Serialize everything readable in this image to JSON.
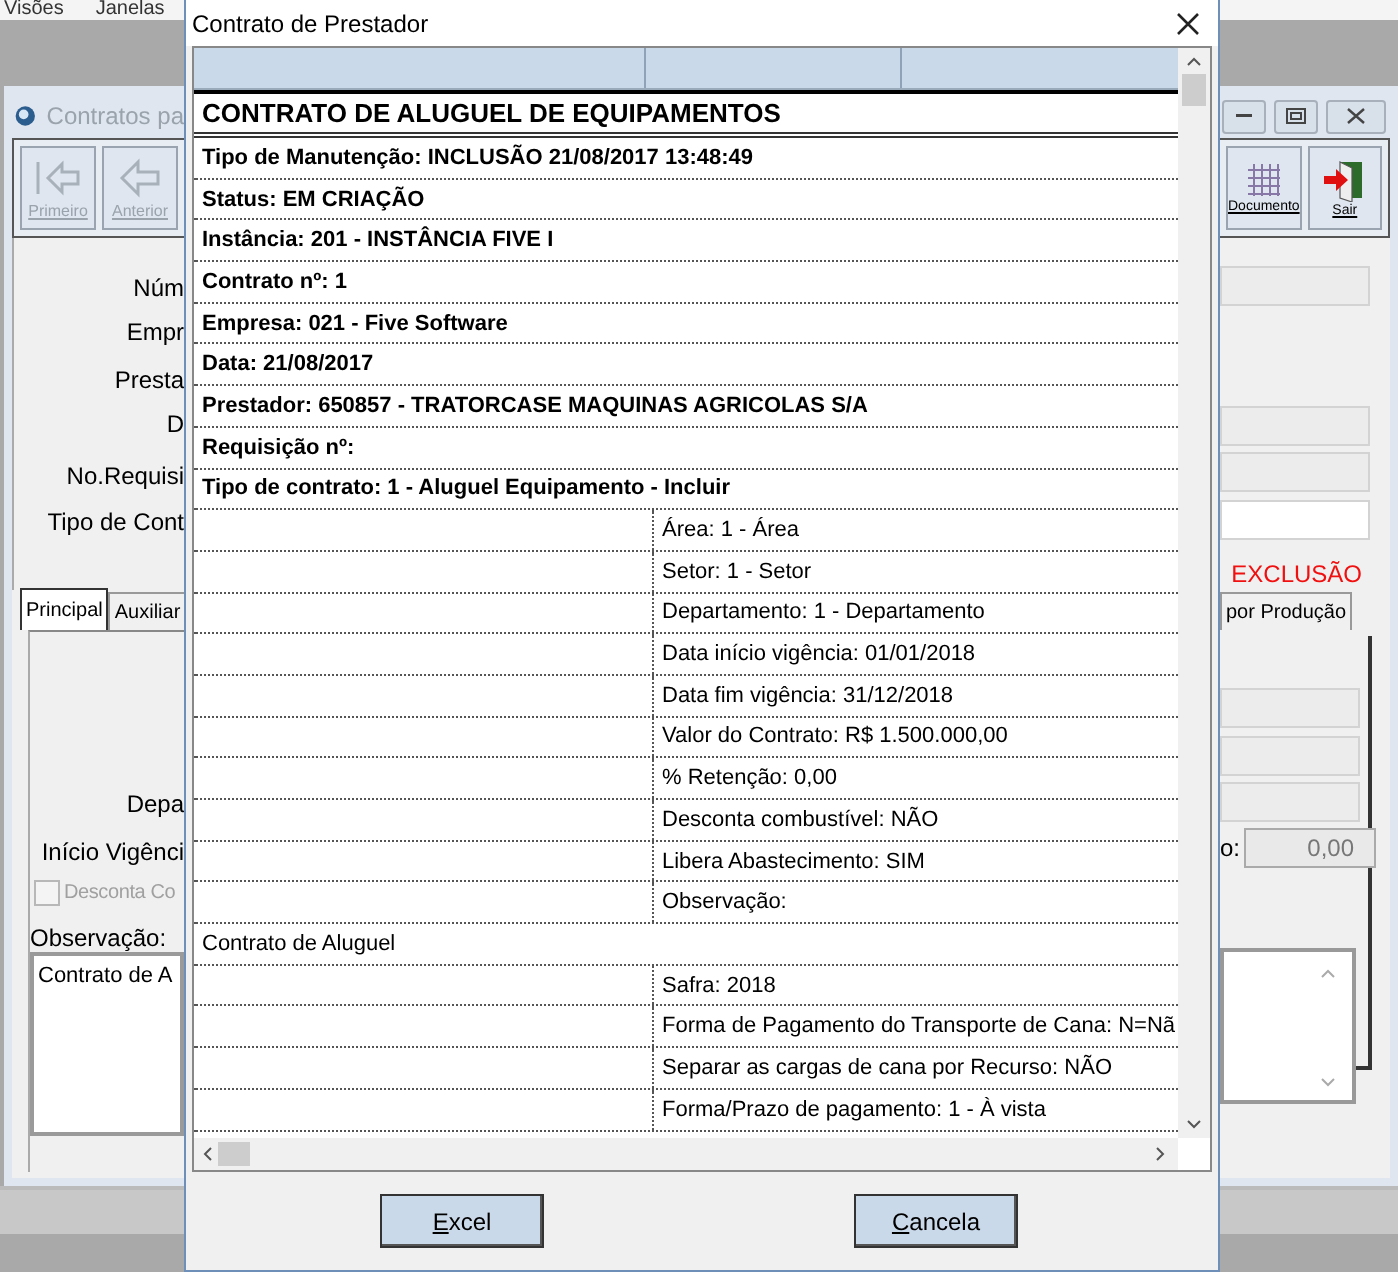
{
  "menu_bar": {
    "items": [
      "Visões",
      "Janelas"
    ]
  },
  "background_window": {
    "title": "Contratos pa",
    "left_toolbar": [
      {
        "label": "Primeiro",
        "kind": "first",
        "disabled": true
      },
      {
        "label": "Anterior",
        "kind": "prev",
        "disabled": true
      }
    ],
    "right_toolbar": [
      {
        "label": "Documento",
        "kind": "grid",
        "disabled": false
      },
      {
        "label": "Sair",
        "kind": "exit",
        "disabled": false
      }
    ],
    "form_labels": [
      "Núm",
      "Empr",
      "Presta",
      "D",
      "No.Requisi",
      "Tipo de Cont"
    ],
    "status_text": "EXCLUSÃO",
    "tabs": [
      {
        "label": "Principal",
        "selected": true
      },
      {
        "label": "Auxiliar",
        "selected": false
      },
      {
        "label": "por Produção",
        "selected": false
      }
    ],
    "tab_labels": [
      "Depa",
      "Início Vigênci"
    ],
    "checkbox": {
      "label": "Desconta Co",
      "checked": false,
      "disabled": true
    },
    "observation_label": "Observação:",
    "observation_value": "Contrato de A",
    "right_label": "o:",
    "right_value": "0,00"
  },
  "dialog": {
    "title": "Contrato de Prestador",
    "rows": [
      {
        "kind": "title",
        "text": "CONTRATO DE ALUGUEL DE EQUIPAMENTOS"
      },
      {
        "kind": "bold",
        "text": "Tipo de Manutenção: INCLUSÃO 21/08/2017 13:48:49"
      },
      {
        "kind": "bold",
        "text": "Status: EM CRIAÇÃO"
      },
      {
        "kind": "bold",
        "text": "Instância: 201 - INSTÂNCIA FIVE I"
      },
      {
        "kind": "bold",
        "text": "Contrato nº: 1"
      },
      {
        "kind": "bold",
        "text": "Empresa: 021 - Five Software"
      },
      {
        "kind": "bold",
        "text": "Data: 21/08/2017"
      },
      {
        "kind": "bold",
        "text": "Prestador: 650857 - TRATORCASE MAQUINAS AGRICOLAS S/A"
      },
      {
        "kind": "bold",
        "text": "Requisição nº:"
      },
      {
        "kind": "bold",
        "text": "Tipo de contrato: 1 - Aluguel Equipamento - Incluir"
      },
      {
        "kind": "split",
        "text": "Área: 1 - Área"
      },
      {
        "kind": "split",
        "text": "Setor: 1 - Setor"
      },
      {
        "kind": "split",
        "text": "Departamento: 1 - Departamento"
      },
      {
        "kind": "split",
        "text": "Data início vigência: 01/01/2018"
      },
      {
        "kind": "split",
        "text": "Data fim vigência: 31/12/2018"
      },
      {
        "kind": "split",
        "text": "Valor do Contrato: R$ 1.500.000,00"
      },
      {
        "kind": "split",
        "text": "% Retenção: 0,00"
      },
      {
        "kind": "split",
        "text": "Desconta combustível: NÃO"
      },
      {
        "kind": "split",
        "text": "Libera Abastecimento: SIM"
      },
      {
        "kind": "split",
        "text": "Observação:"
      },
      {
        "kind": "plain",
        "text": "Contrato de Aluguel"
      },
      {
        "kind": "split",
        "text": "Safra: 2018"
      },
      {
        "kind": "split",
        "text": "Forma de Pagamento do Transporte de Cana: N=Nã"
      },
      {
        "kind": "split",
        "text": "Separar as cargas de cana por Recurso: NÃO"
      },
      {
        "kind": "split",
        "text": "Forma/Prazo de pagamento: 1 - À vista"
      }
    ],
    "buttons": [
      {
        "label": "Excel"
      },
      {
        "label": "Cancela"
      }
    ]
  }
}
